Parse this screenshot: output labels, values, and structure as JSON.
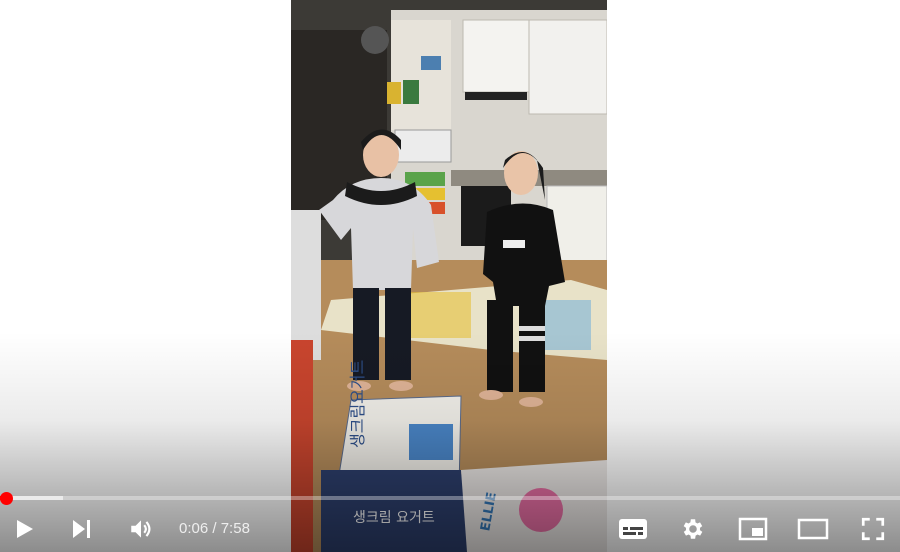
{
  "player": {
    "time_current": "0:06",
    "time_separator": " / ",
    "time_total": "7:58",
    "progress_played_fraction": 0.007,
    "progress_loaded_fraction": 0.07,
    "accent_color": "#ff0000"
  },
  "video": {
    "box_text_top": "생크림요거트",
    "box_text_bottom": "생크림 요거트",
    "mat_text": "ELLIE"
  },
  "icons": {
    "play": "play-icon",
    "next": "skip-next-icon",
    "volume": "volume-icon",
    "subtitles": "subtitles-icon",
    "settings": "gear-icon",
    "miniplayer": "miniplayer-icon",
    "theater": "theater-mode-icon",
    "fullscreen": "fullscreen-icon"
  }
}
